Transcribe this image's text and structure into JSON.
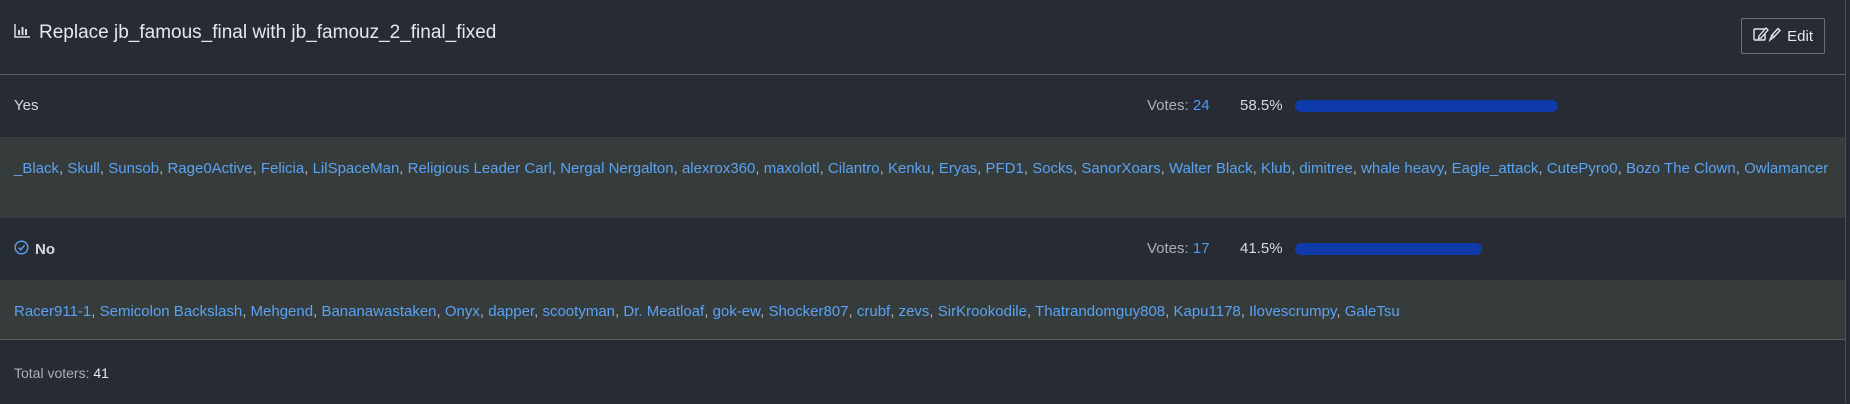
{
  "poll": {
    "title": "Replace jb_famous_final with jb_famouz_2_final_fixed",
    "edit_label": "Edit",
    "options": [
      {
        "label": "Yes",
        "votes_label": "Votes:",
        "votes": "24",
        "percent_text": "58.5%",
        "percent": 58.5,
        "selected": false,
        "voters": [
          "_Black",
          "Skull",
          "Sunsob",
          "Rage0Active",
          "Felicia",
          "LilSpaceMan",
          "Religious Leader Carl",
          "Nergal Nergalton",
          "alexrox360",
          "maxolotl",
          "Cilantro",
          "Kenku",
          "Eryas",
          "PFD1",
          "Socks",
          "SanorXoars",
          "Walter Black",
          "Klub",
          "dimitree",
          "whale heavy",
          "Eagle_attack",
          "CutePyro0",
          "Bozo The Clown",
          "Owlamancer"
        ]
      },
      {
        "label": "No",
        "votes_label": "Votes:",
        "votes": "17",
        "percent_text": "41.5%",
        "percent": 41.5,
        "selected": true,
        "voters": [
          "Racer911-1",
          "Semicolon Backslash",
          "Mehgend",
          "Bananawastaken",
          "Onyx",
          "dapper",
          "scootyman",
          "Dr. Meatloaf",
          "gok-ew",
          "Shocker807",
          "crubf",
          "zevs",
          "SirKrookodile",
          "Thatrandomguy808",
          "Kapu1178",
          "Ilovescrumpy",
          "GaleTsu"
        ]
      }
    ],
    "total_label": "Total voters:",
    "total": "41"
  },
  "icons": {
    "title_icon": "bar-chart-icon",
    "edit_icon": "edit-icon",
    "selected_icon": "check-circle-icon"
  },
  "colors": {
    "bar": "#0f3aa9",
    "link": "#5aa3f2",
    "background": "#272b34",
    "voters_bg": "#363b3c"
  }
}
